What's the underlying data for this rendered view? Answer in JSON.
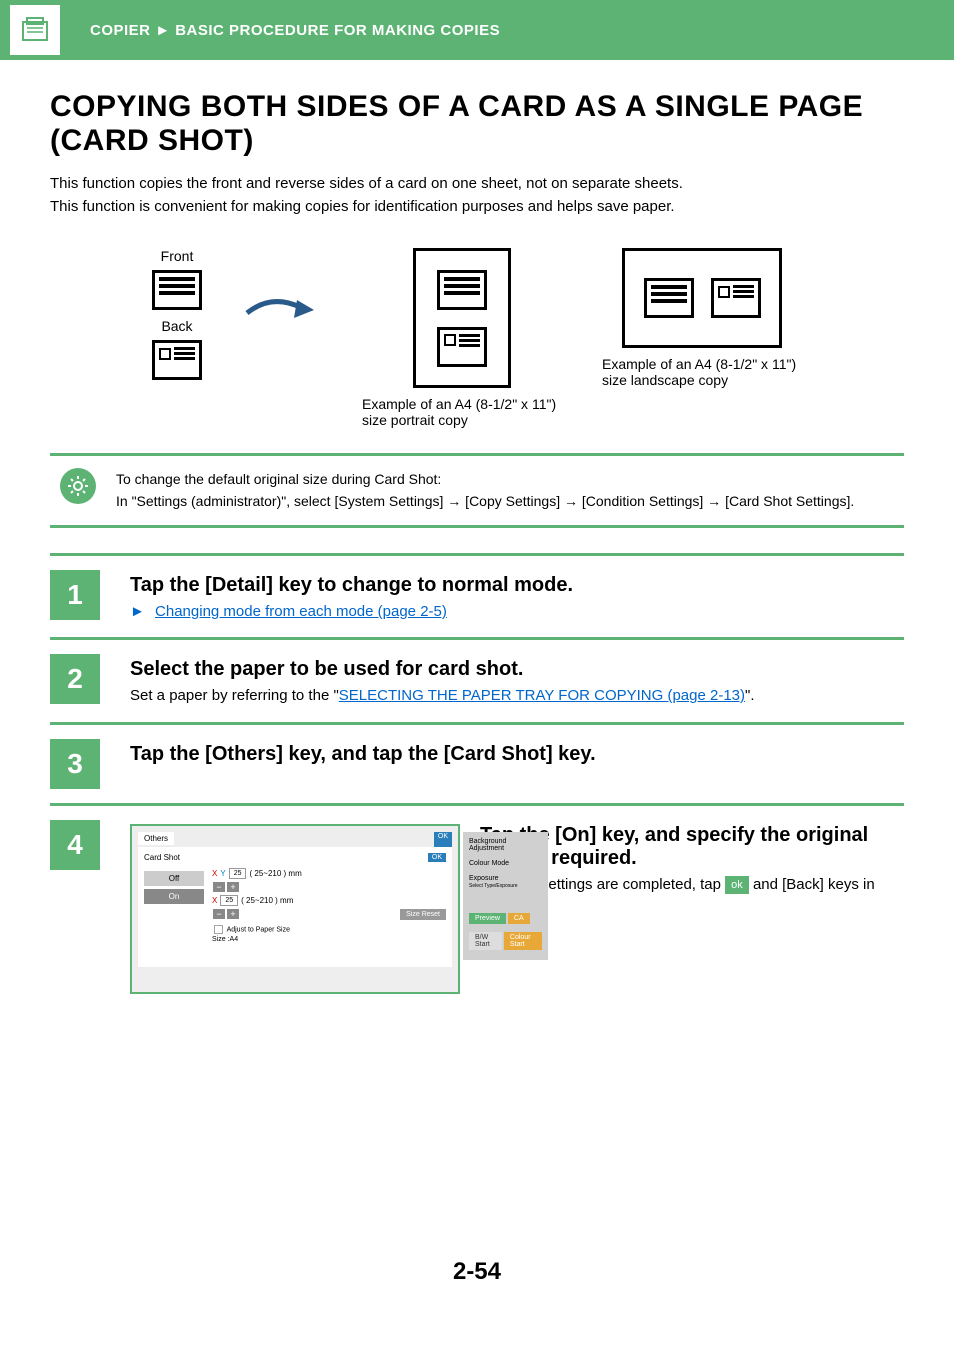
{
  "header": {
    "breadcrumb_section": "COPIER",
    "breadcrumb_sep": "►",
    "breadcrumb_page": "BASIC PROCEDURE FOR MAKING COPIES"
  },
  "title": "COPYING BOTH SIDES OF A CARD AS A SINGLE PAGE (CARD SHOT)",
  "intro_line1": "This function copies the front and reverse sides of a card on one sheet, not on separate sheets.",
  "intro_line2": "This function is convenient for making copies for identification purposes and helps save paper.",
  "diagram": {
    "front_label": "Front",
    "back_label": "Back",
    "portrait_caption": "Example of an A4 (8-1/2\" x 11\") size portrait copy",
    "landscape_caption": "Example of an A4 (8-1/2\" x 11\") size landscape copy"
  },
  "note": {
    "line1": "To change the default original size during Card Shot:",
    "line2": "In \"Settings (administrator)\", select [System Settings] → [Copy Settings] → [Condition Settings] → [Card Shot Settings]."
  },
  "steps": {
    "s1": {
      "num": "1",
      "title": "Tap the [Detail] key to change to normal mode.",
      "link_prefix": "►",
      "link_text": "Changing mode from each mode (page 2-5)"
    },
    "s2": {
      "num": "2",
      "title": "Select the paper to be used for card shot.",
      "text_before": "Set a paper by referring to the \"",
      "link_text": "SELECTING THE PAPER TRAY FOR COPYING (page 2-13)",
      "text_after": "\"."
    },
    "s3": {
      "num": "3",
      "title": "Tap the [Others] key, and tap the [Card Shot] key."
    },
    "s4": {
      "num": "4",
      "title": "Tap the [On] key, and specify the original size as required.",
      "text_before": "After the settings are completed, tap ",
      "ok_label": "ok",
      "text_after": " and [Back] keys in sequence."
    }
  },
  "panel": {
    "others": "Others",
    "card_shot": "Card Shot",
    "ok": "OK",
    "off": "Off",
    "on": "On",
    "x": "X",
    "y": "Y",
    "val": "25",
    "range": "( 25~210 ) mm",
    "size_reset": "Size Reset",
    "adjust": "Adjust to Paper Size",
    "size_label": "Size",
    "size_val": ":A4",
    "side_bg": "Background Adjustment",
    "side_colour": "Colour Mode",
    "side_exposure": "Exposure",
    "side_exposure_sub": "Select Type/Exposure",
    "preview": "Preview",
    "ca": "CA",
    "bw": "B/W Start",
    "colour": "Colour Start"
  },
  "footer": "2-54"
}
